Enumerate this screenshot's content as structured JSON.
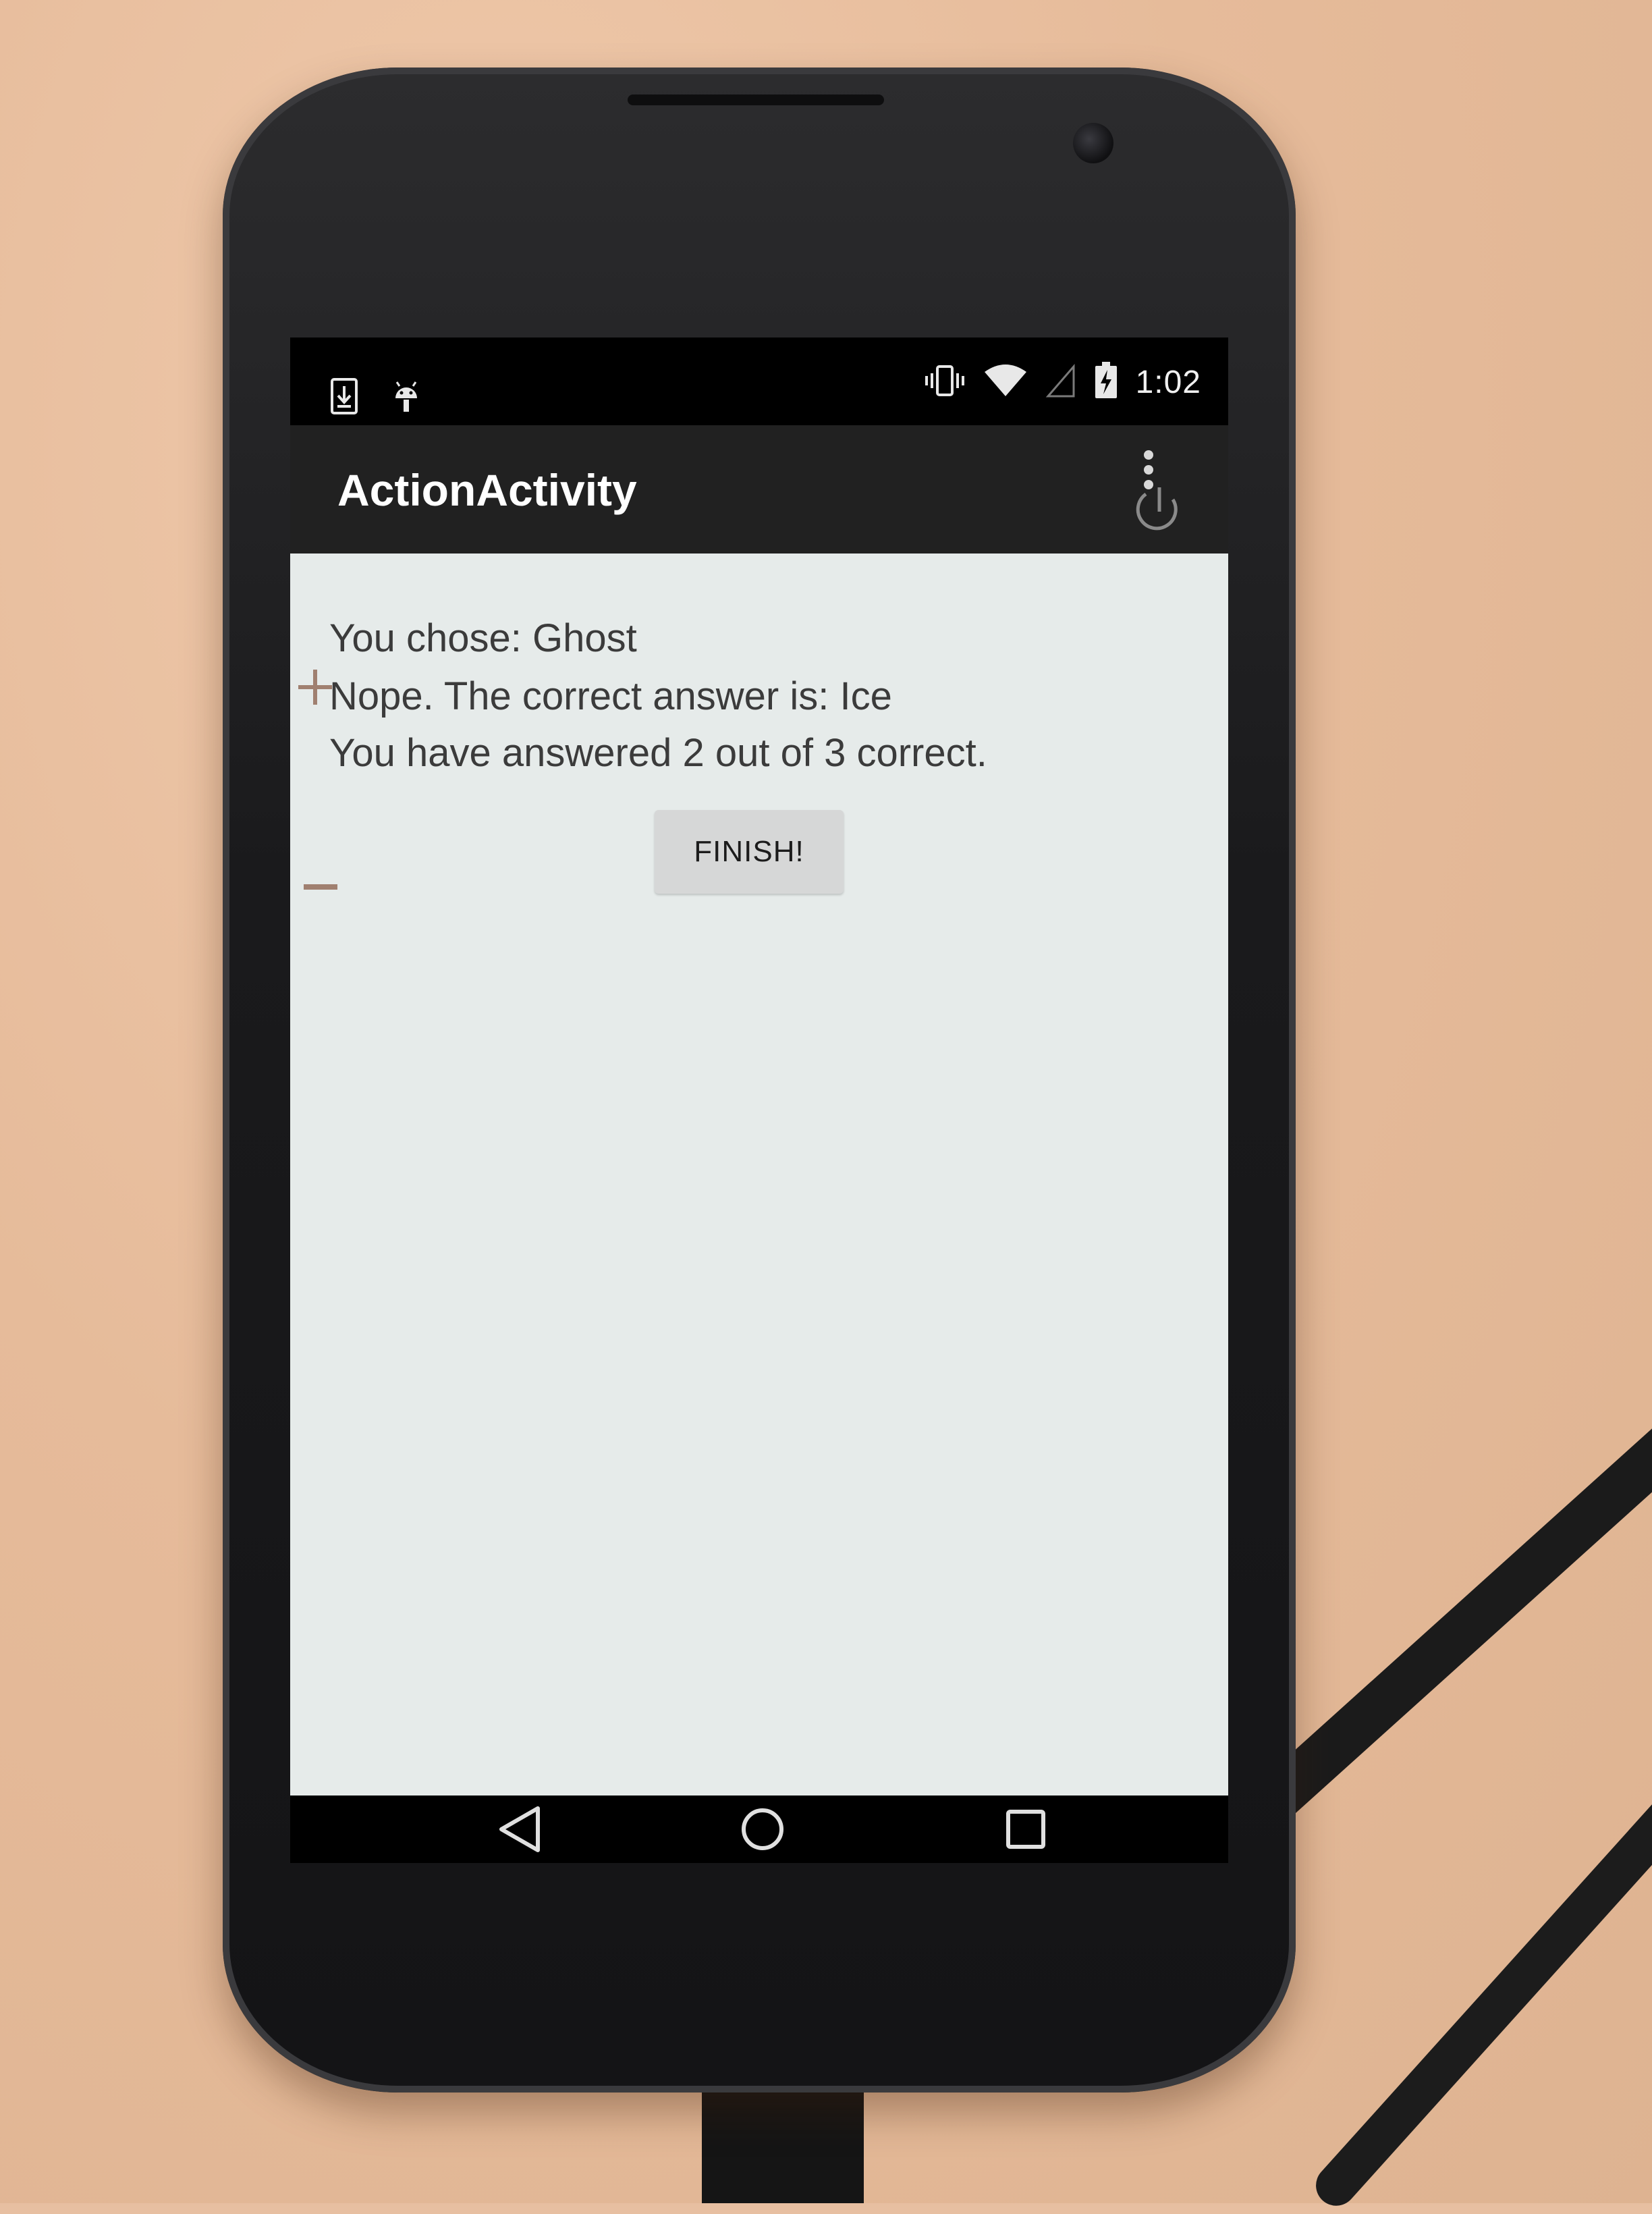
{
  "status_bar": {
    "time": "1:02",
    "left_icons": [
      "download-notification-icon",
      "android-debug-icon"
    ],
    "right_icons": [
      "vibrate-icon",
      "wifi-icon",
      "cell-signal-icon",
      "battery-charging-icon"
    ]
  },
  "action_bar": {
    "title": "ActionActivity",
    "overflow_icon": "overflow-menu-icon"
  },
  "content": {
    "line1": "You chose: Ghost",
    "line2": "Nope. The correct answer is: Ice",
    "line3": "You have answered 2 out of 3 correct.",
    "finish_label": "FINISH!"
  },
  "nav_bar": {
    "back_icon": "back-icon",
    "home_icon": "home-icon",
    "recents_icon": "recents-icon"
  },
  "colors": {
    "status_bar": "#000000",
    "action_bar": "#212121",
    "content_bg": "#e6ebea",
    "text": "#3b3b3b",
    "button_bg": "#d6d7d7"
  }
}
